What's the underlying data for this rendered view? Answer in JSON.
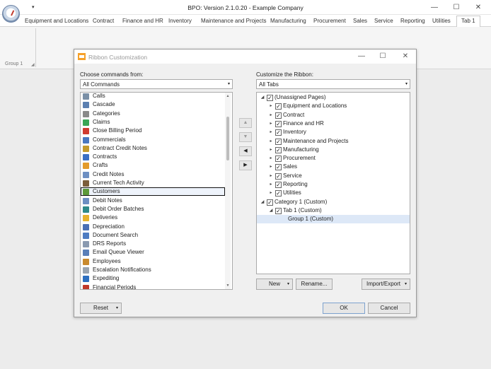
{
  "app": {
    "title": "BPO: Version 2.1.0.20 - Example Company",
    "qat_glyph": "▾",
    "window_controls": {
      "minimize": "—",
      "maximize": "☐",
      "close": "✕"
    }
  },
  "ribbon": {
    "tabs": [
      "Equipment and Locations",
      "Contract",
      "Finance and HR",
      "Inventory",
      "Maintenance and Projects",
      "Manufacturing",
      "Procurement",
      "Sales",
      "Service",
      "Reporting",
      "Utilities",
      "Tab 1"
    ],
    "active_tab": "Tab 1",
    "group_label": "Group 1",
    "group_launcher_glyph": "◢"
  },
  "dialog": {
    "title": "Ribbon Customization",
    "controls": {
      "minimize": "—",
      "maximize": "☐",
      "close": "✕"
    },
    "left": {
      "label": "Choose commands from:",
      "combo_value": "All Commands",
      "combo_glyph": "▾",
      "selected": "Customers",
      "items": [
        {
          "label": "Calls",
          "icon": "calls-icon",
          "color": "#7a8fa6"
        },
        {
          "label": "Cascade",
          "icon": "cascade-icon",
          "color": "#5b7fb0"
        },
        {
          "label": "Categories",
          "icon": "categories-icon",
          "color": "#8a8a8a"
        },
        {
          "label": "Claims",
          "icon": "claims-icon",
          "color": "#3aa655"
        },
        {
          "label": "Close Billing Period",
          "icon": "close-billing-icon",
          "color": "#d03b2f"
        },
        {
          "label": "Commercials",
          "icon": "commercials-icon",
          "color": "#4a78c0"
        },
        {
          "label": "Contract Credit Notes",
          "icon": "credit-notes-icon",
          "color": "#c49a2c"
        },
        {
          "label": "Contracts",
          "icon": "contracts-icon",
          "color": "#3b6fc4"
        },
        {
          "label": "Crafts",
          "icon": "crafts-icon",
          "color": "#e39b2b"
        },
        {
          "label": "Credit Notes",
          "icon": "credit-notes-icon",
          "color": "#6d8fc2"
        },
        {
          "label": "Current Tech Activity",
          "icon": "tech-activity-icon",
          "color": "#7b5e3b"
        },
        {
          "label": "Customers",
          "icon": "customers-icon",
          "color": "#5d9a3a"
        },
        {
          "label": "Debit Notes",
          "icon": "debit-notes-icon",
          "color": "#6d8fc2"
        },
        {
          "label": "Debit Order Batches",
          "icon": "debit-orders-icon",
          "color": "#2e8a8a"
        },
        {
          "label": "Deliveries",
          "icon": "deliveries-icon",
          "color": "#e6b22e"
        },
        {
          "label": "Depreciation",
          "icon": "depreciation-icon",
          "color": "#4a6fb5"
        },
        {
          "label": "Document Search",
          "icon": "document-search-icon",
          "color": "#4e7cc2"
        },
        {
          "label": "DRS Reports",
          "icon": "reports-icon",
          "color": "#8a9ab0"
        },
        {
          "label": "Email Queue Viewer",
          "icon": "email-icon",
          "color": "#5a7fb8"
        },
        {
          "label": "Employees",
          "icon": "employees-icon",
          "color": "#c98a2e"
        },
        {
          "label": "Escalation Notifications",
          "icon": "escalation-icon",
          "color": "#9aa4b0"
        },
        {
          "label": "Expediting",
          "icon": "expediting-icon",
          "color": "#2d6fc0"
        },
        {
          "label": "Financial Periods",
          "icon": "financial-periods-icon",
          "color": "#c0392b"
        }
      ]
    },
    "move_buttons": [
      {
        "glyph": "▲",
        "name": "move-up-button",
        "enabled": false
      },
      {
        "glyph": "▼",
        "name": "move-down-button",
        "enabled": false
      },
      {
        "glyph": "◀",
        "name": "remove-from-ribbon-button",
        "enabled": true
      },
      {
        "glyph": "▶",
        "name": "add-to-ribbon-button",
        "enabled": true
      }
    ],
    "right": {
      "label": "Customize the Ribbon:",
      "combo_value": "All Tabs",
      "combo_glyph": "▾",
      "check_glyph": "✓",
      "tree": [
        {
          "label": "(Unassigned Pages)",
          "level": 0,
          "toggle": "◢"
        },
        {
          "label": "Equipment and Locations",
          "level": 1,
          "toggle": "▸"
        },
        {
          "label": "Contract",
          "level": 1,
          "toggle": "▸"
        },
        {
          "label": "Finance and HR",
          "level": 1,
          "toggle": "▸"
        },
        {
          "label": "Inventory",
          "level": 1,
          "toggle": "▸"
        },
        {
          "label": "Maintenance and Projects",
          "level": 1,
          "toggle": "▸"
        },
        {
          "label": "Manufacturing",
          "level": 1,
          "toggle": "▸"
        },
        {
          "label": "Procurement",
          "level": 1,
          "toggle": "▸"
        },
        {
          "label": "Sales",
          "level": 1,
          "toggle": "▸"
        },
        {
          "label": "Service",
          "level": 1,
          "toggle": "▸"
        },
        {
          "label": "Reporting",
          "level": 1,
          "toggle": "▸"
        },
        {
          "label": "Utilities",
          "level": 1,
          "toggle": "▸"
        },
        {
          "label": "Category 1 (Custom)",
          "level": 0,
          "toggle": "◢"
        },
        {
          "label": "Tab 1 (Custom)",
          "level": 1,
          "toggle": "◢"
        },
        {
          "label": "Group 1 (Custom)",
          "level": 2,
          "toggle": "",
          "selected": true
        }
      ]
    },
    "buttons": {
      "new": "New",
      "rename": "Rename...",
      "import_export": "Import/Export",
      "reset": "Reset",
      "ok": "OK",
      "cancel": "Cancel",
      "dropdown_glyph": "▾"
    }
  }
}
